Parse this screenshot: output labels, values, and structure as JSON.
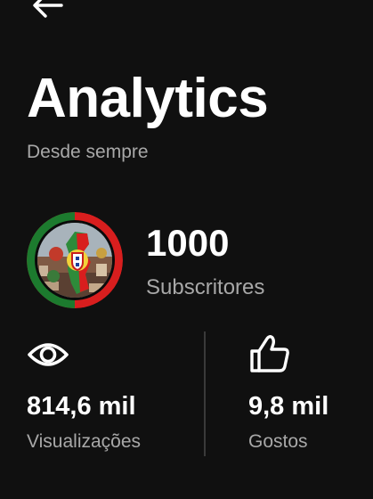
{
  "header": {
    "back_icon": "arrow-left-icon",
    "title": "Analytics",
    "subtitle": "Desde sempre"
  },
  "channel": {
    "avatar_icon": "channel-avatar",
    "subscribers_count": "1000",
    "subscribers_label": "Subscritores"
  },
  "stats": {
    "views": {
      "icon": "eye-icon",
      "value": "814,6 mil",
      "label": "Visualizações"
    },
    "likes": {
      "icon": "thumbs-up-icon",
      "value": "9,8 mil",
      "label": "Gostos"
    }
  },
  "colors": {
    "background": "#101010",
    "text_primary": "#ffffff",
    "text_secondary": "#a8a8a8",
    "divider": "#3a3a3a",
    "avatar_ring_red": "#d81e1e",
    "avatar_ring_green": "#1c7a2e"
  }
}
